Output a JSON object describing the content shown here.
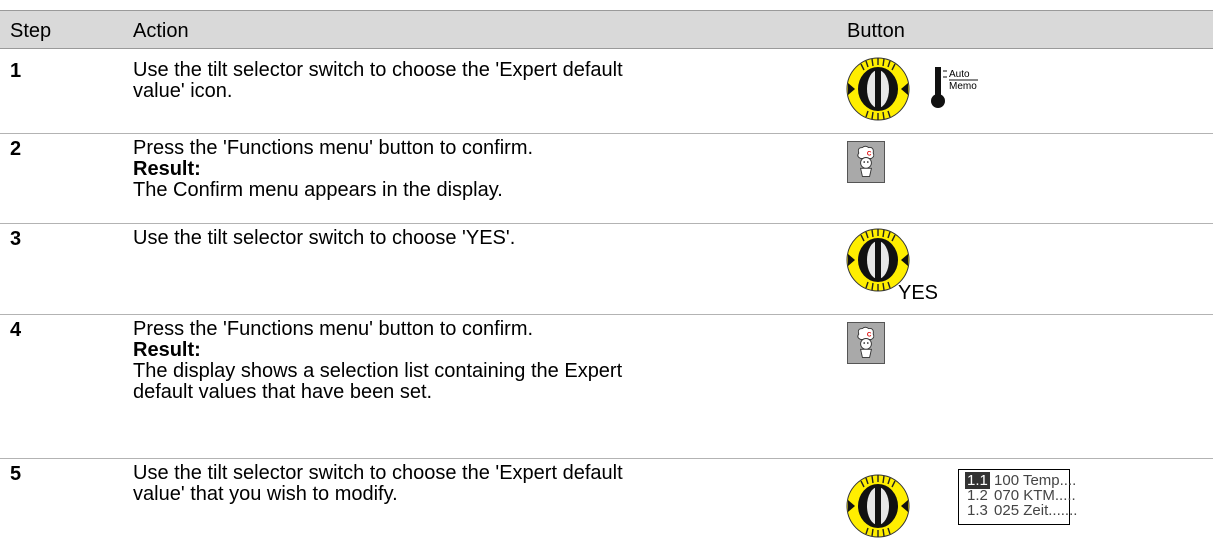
{
  "table": {
    "headers": {
      "step": "Step",
      "action": "Action",
      "button": "Button"
    },
    "rows": [
      {
        "step": "1",
        "action_lines": [
          "Use the tilt selector switch to choose the 'Expert default",
          "value' icon."
        ],
        "buttons": [
          "tilt-selector-switch",
          "auto-memo-thermometer-icon"
        ],
        "icon_text": {
          "top": "Auto",
          "bottom": "Memo"
        }
      },
      {
        "step": "2",
        "action_lines": [
          "Press the 'Functions menu' button to confirm."
        ],
        "result_label": "Result:",
        "result_lines": [
          "The Confirm menu appears in the display."
        ],
        "buttons": [
          "functions-menu-button"
        ]
      },
      {
        "step": "3",
        "action_lines": [
          "Use the tilt selector switch to choose 'YES'."
        ],
        "buttons": [
          "tilt-selector-switch"
        ],
        "button_text": "YES"
      },
      {
        "step": "4",
        "action_lines": [
          "Press the 'Functions menu' button to confirm."
        ],
        "result_label": "Result:",
        "result_lines": [
          "The display shows a selection list containing the Expert",
          "default values that have been set."
        ],
        "buttons": [
          "functions-menu-button"
        ]
      },
      {
        "step": "5",
        "action_lines": [
          "Use the tilt selector switch to choose the 'Expert default",
          "value' that you wish to modify."
        ],
        "buttons": [
          "tilt-selector-switch",
          "display-list"
        ],
        "list": [
          {
            "index": "1.1",
            "text": "100 Temp...."
          },
          {
            "index": "1.2",
            "text": "070 KTM....."
          },
          {
            "index": "1.3",
            "text": "025 Zeit......."
          }
        ]
      }
    ]
  },
  "colors": {
    "header_bg": "#d9d9d9",
    "knob_yellow": "#ffee00",
    "knob_dark": "#111111",
    "button_gray": "#a9a9a9"
  }
}
